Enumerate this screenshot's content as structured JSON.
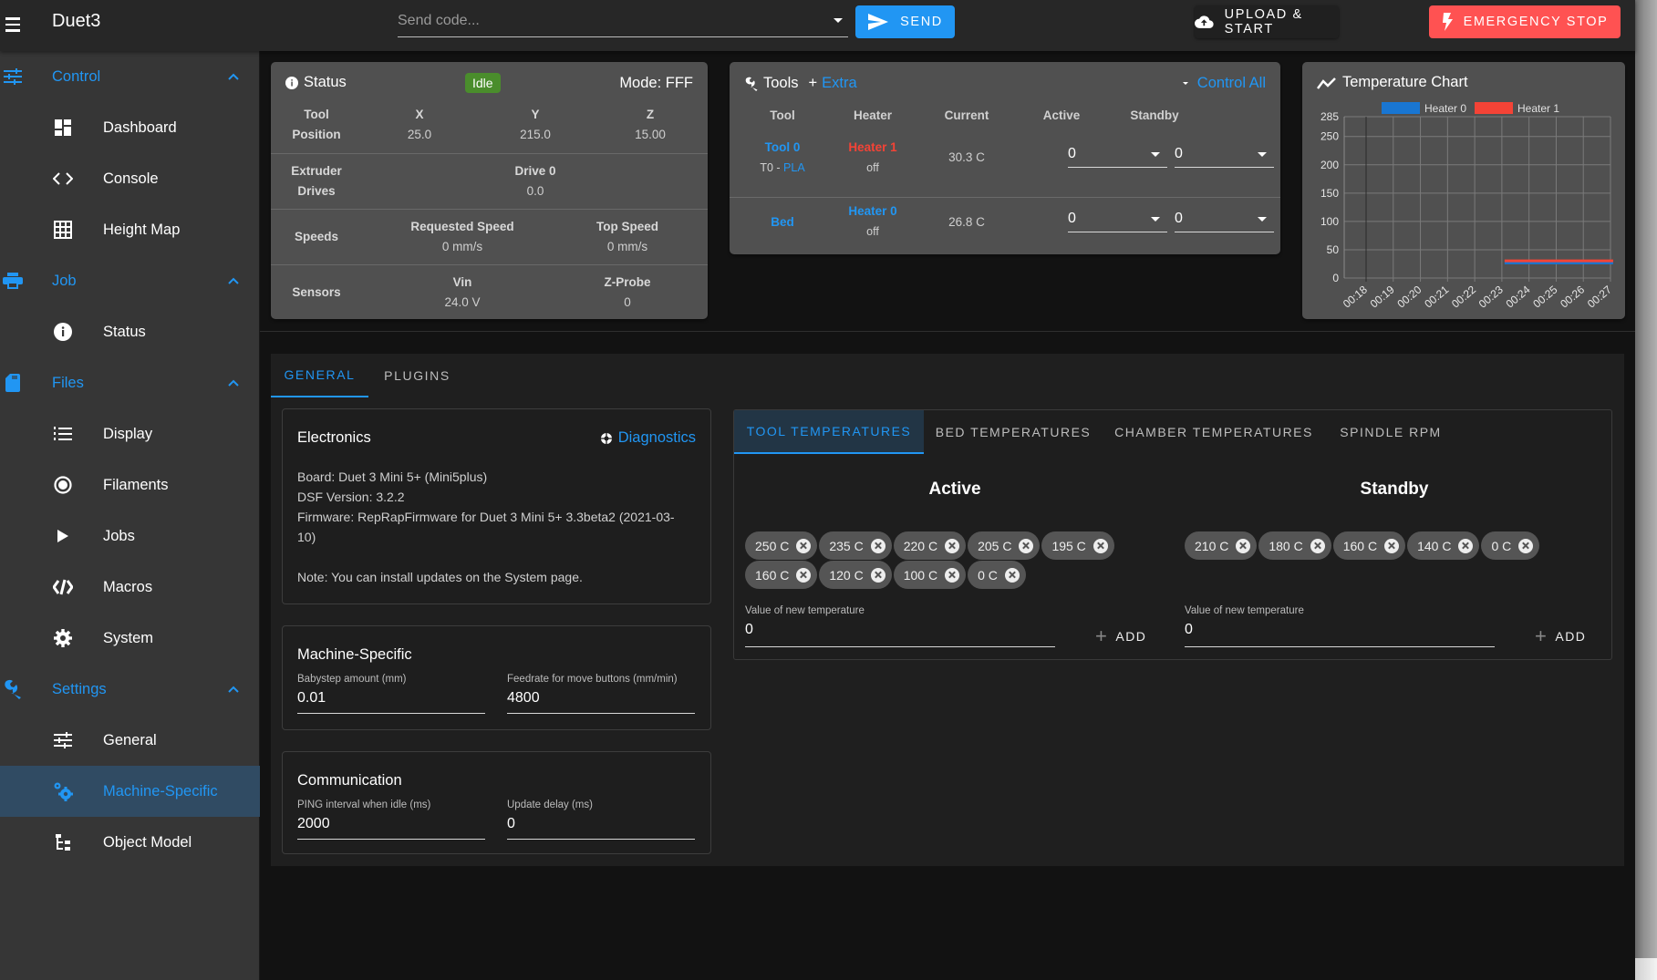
{
  "app": {
    "title": "Duet3"
  },
  "toolbar": {
    "code_placeholder": "Send code...",
    "send_label": "Send",
    "upload_label": "Upload & Start",
    "estop_label": "Emergency Stop"
  },
  "sidebar": {
    "groups": [
      {
        "label": "Control",
        "icon": "tune-icon",
        "items": [
          {
            "label": "Dashboard",
            "icon": "dashboard-icon"
          },
          {
            "label": "Console",
            "icon": "code-icon"
          },
          {
            "label": "Height Map",
            "icon": "grid-icon"
          }
        ]
      },
      {
        "label": "Job",
        "icon": "printer-icon",
        "items": [
          {
            "label": "Status",
            "icon": "info-icon"
          }
        ]
      },
      {
        "label": "Files",
        "icon": "sd-card-icon",
        "items": [
          {
            "label": "Display",
            "icon": "numbered-list-icon"
          },
          {
            "label": "Filaments",
            "icon": "radio-button-icon"
          },
          {
            "label": "Jobs",
            "icon": "play-icon"
          },
          {
            "label": "Macros",
            "icon": "macro-icon"
          },
          {
            "label": "System",
            "icon": "gear-icon"
          }
        ]
      },
      {
        "label": "Settings",
        "icon": "wrench-icon",
        "items": [
          {
            "label": "General",
            "icon": "tune-icon"
          },
          {
            "label": "Machine-Specific",
            "icon": "gears-icon",
            "active": true
          },
          {
            "label": "Object Model",
            "icon": "file-tree-icon"
          }
        ]
      }
    ]
  },
  "status": {
    "title": "Status",
    "state": "Idle",
    "mode": "Mode: FFF",
    "position_label": [
      "Tool",
      "Position"
    ],
    "axes": [
      {
        "name": "X",
        "value": "25.0"
      },
      {
        "name": "Y",
        "value": "215.0"
      },
      {
        "name": "Z",
        "value": "15.00"
      }
    ],
    "extruder_label": [
      "Extruder",
      "Drives"
    ],
    "drive": {
      "name": "Drive 0",
      "value": "0.0"
    },
    "speeds_label": "Speeds",
    "requested_speed": {
      "label": "Requested Speed",
      "value": "0 mm/s"
    },
    "top_speed": {
      "label": "Top Speed",
      "value": "0 mm/s"
    },
    "sensors_label": "Sensors",
    "vin": {
      "label": "Vin",
      "value": "24.0 V"
    },
    "zprobe": {
      "label": "Z-Probe",
      "value": "0"
    }
  },
  "tools": {
    "title": "Tools",
    "extra": "Extra",
    "control_all": "Control All",
    "headers": [
      "Tool",
      "Heater",
      "Current",
      "Active",
      "Standby"
    ],
    "rows": [
      {
        "tool": "Tool 0",
        "sub_prefix": "T0 - ",
        "sub_link": "PLA",
        "heater": "Heater 1",
        "heater_color": "#f44336",
        "heater_state": "off",
        "current": "30.3 C",
        "active": "0",
        "standby": "0"
      },
      {
        "tool": "Bed",
        "sub_prefix": "",
        "sub_link": "",
        "heater": "Heater 0",
        "heater_color": "#2196f3",
        "heater_state": "off",
        "current": "26.8 C",
        "active": "0",
        "standby": "0"
      }
    ]
  },
  "chart_data": {
    "type": "line",
    "title": "Temperature Chart",
    "xlabel": "",
    "ylabel": "",
    "ylim": [
      0,
      285
    ],
    "yticks": [
      0,
      50,
      100,
      150,
      200,
      250,
      285
    ],
    "x": [
      "00:18",
      "00:19",
      "00:20",
      "00:21",
      "00:22",
      "00:23",
      "00:24",
      "00:25",
      "00:26",
      "00:27"
    ],
    "grid": true,
    "legend": "top-center",
    "series": [
      {
        "name": "Heater 0",
        "color": "#1976d2",
        "points": [
          [
            5.1,
            26.8
          ],
          [
            9.1,
            26.8
          ]
        ]
      },
      {
        "name": "Heater 1",
        "color": "#f44336",
        "points": [
          [
            5.1,
            30.3
          ],
          [
            9.1,
            30.3
          ]
        ]
      }
    ]
  },
  "settings": {
    "tabs": [
      "General",
      "Plugins"
    ],
    "active_tab": 0,
    "electronics": {
      "title": "Electronics",
      "diagnostics": "Diagnostics",
      "lines": [
        "Board: Duet 3 Mini 5+ (Mini5plus)",
        "DSF Version: 3.2.2",
        "Firmware: RepRapFirmware for Duet 3 Mini 5+ 3.3beta2 (2021-03-10)"
      ],
      "note": "Note: You can install updates on the System page."
    },
    "machine": {
      "title": "Machine-Specific",
      "babystep": {
        "label": "Babystep amount (mm)",
        "value": "0.01"
      },
      "feedrate": {
        "label": "Feedrate for move buttons (mm/min)",
        "value": "4800"
      }
    },
    "communication": {
      "title": "Communication",
      "ping": {
        "label": "PING interval when idle (ms)",
        "value": "2000"
      },
      "update_delay": {
        "label": "Update delay (ms)",
        "value": "0"
      }
    }
  },
  "temps": {
    "tabs": [
      "Tool Temperatures",
      "Bed Temperatures",
      "Chamber Temperatures",
      "Spindle RPM"
    ],
    "active_tab": 0,
    "active": {
      "title": "Active",
      "values": [
        "250 C",
        "235 C",
        "220 C",
        "205 C",
        "195 C",
        "160 C",
        "120 C",
        "100 C",
        "0 C"
      ],
      "input_label": "Value of new temperature",
      "input_value": "0",
      "add_label": "Add"
    },
    "standby": {
      "title": "Standby",
      "values": [
        "210 C",
        "180 C",
        "160 C",
        "140 C",
        "0 C"
      ],
      "input_label": "Value of new temperature",
      "input_value": "0",
      "add_label": "Add"
    }
  }
}
